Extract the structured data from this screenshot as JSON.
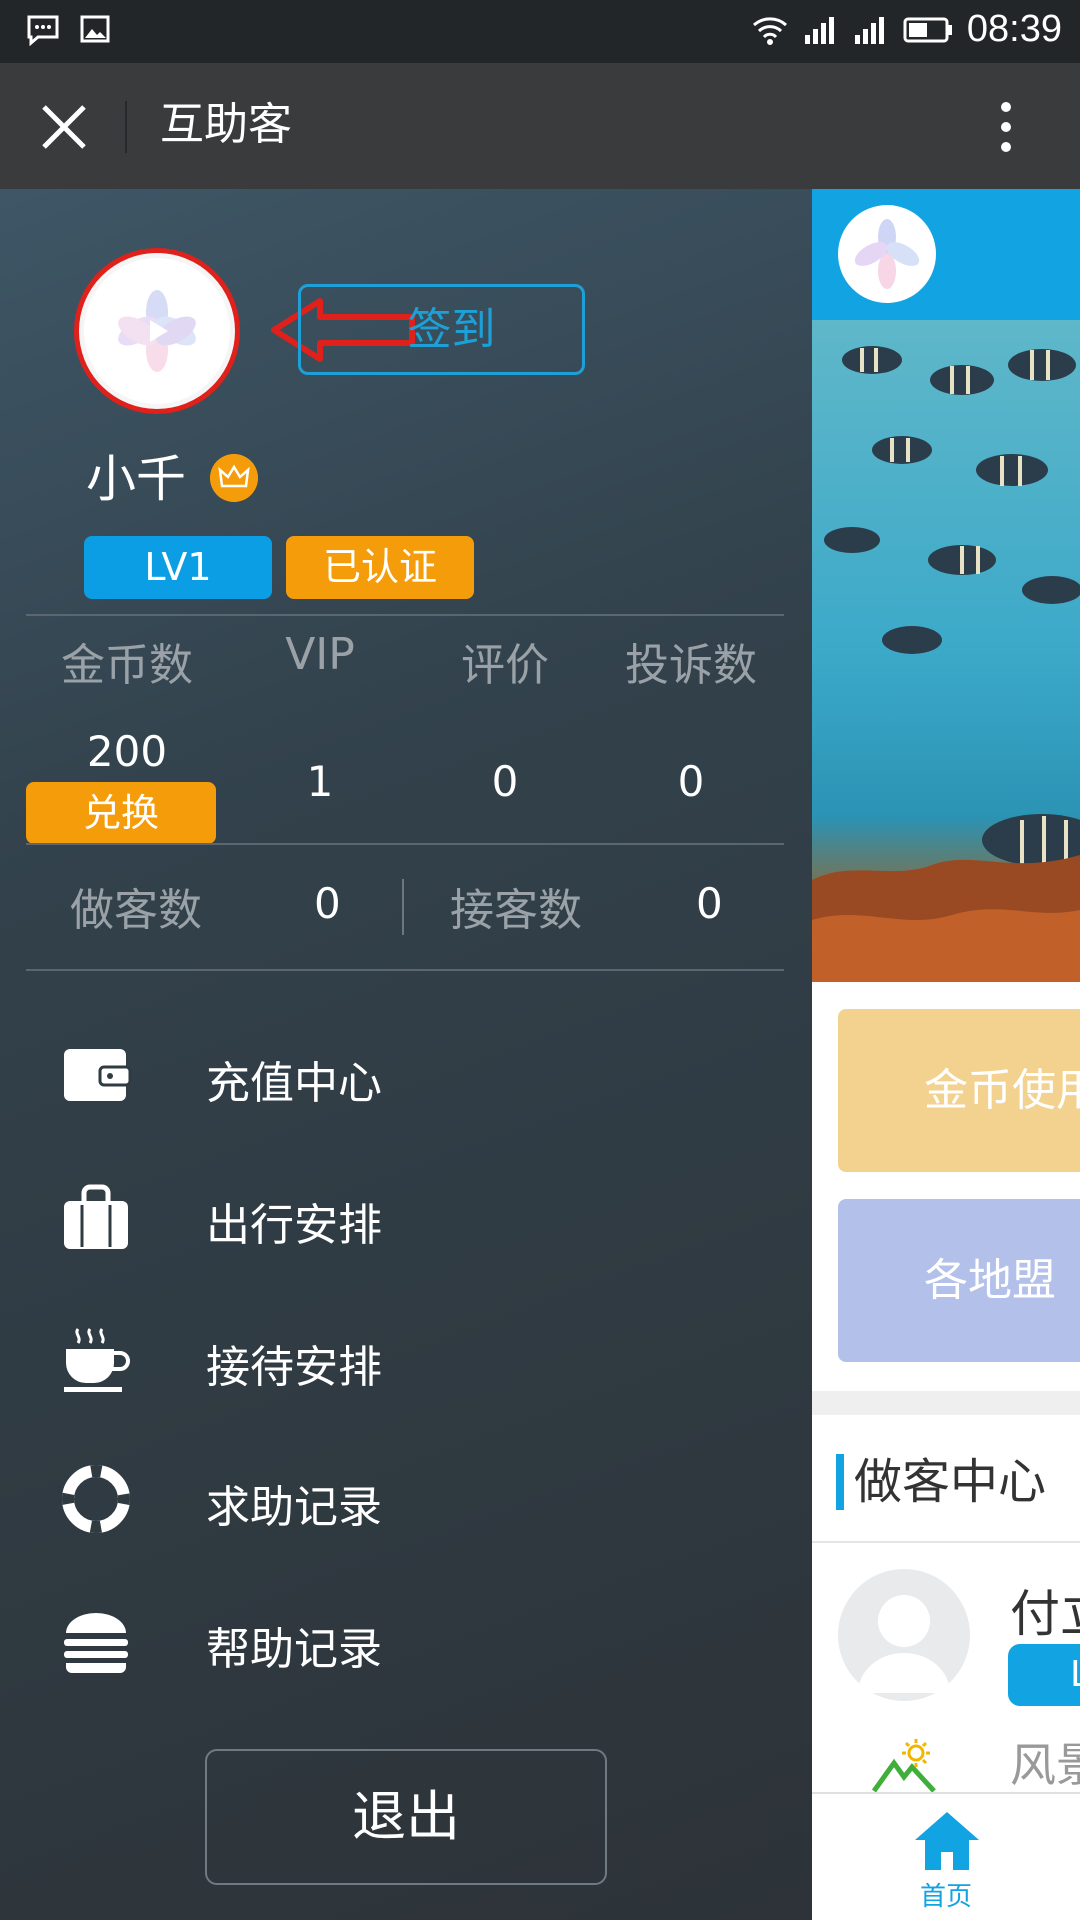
{
  "status_bar": {
    "time": "08:39",
    "icons": [
      "message-icon",
      "image-icon",
      "wifi-icon",
      "signal-icon",
      "signal-icon",
      "battery-icon"
    ]
  },
  "header": {
    "title": "互助客",
    "close_icon": "close-icon",
    "more_icon": "more-vertical-icon"
  },
  "profile": {
    "sign_in_label": "签到",
    "username": "小千",
    "level_badge": "LV1",
    "verified_badge": "已认证"
  },
  "stats": {
    "headers": [
      "金币数",
      "VIP",
      "评价",
      "投诉数"
    ],
    "coins": "200",
    "exchange_label": "兑换",
    "vip": "1",
    "reviews": "0",
    "complaints": "0",
    "host_label": "做客数",
    "host_value": "0",
    "receive_label": "接客数",
    "receive_value": "0"
  },
  "menu": [
    {
      "label": "充值中心",
      "icon": "wallet-icon"
    },
    {
      "label": "出行安排",
      "icon": "bag-icon"
    },
    {
      "label": "接待安排",
      "icon": "coffee-icon"
    },
    {
      "label": "求助记录",
      "icon": "lifebuoy-icon"
    },
    {
      "label": "帮助记录",
      "icon": "burger-icon"
    }
  ],
  "logout_label": "退出",
  "right_panel": {
    "card1": "金币使用",
    "card2": "各地盟",
    "section_title": "做客中心",
    "person_name": "付立",
    "person_level": "LV",
    "scenery_label": "风景",
    "tab_home": "首页"
  },
  "colors": {
    "accent": "#12a3e3",
    "orange": "#f59c0a",
    "annotation": "#e0201a"
  }
}
